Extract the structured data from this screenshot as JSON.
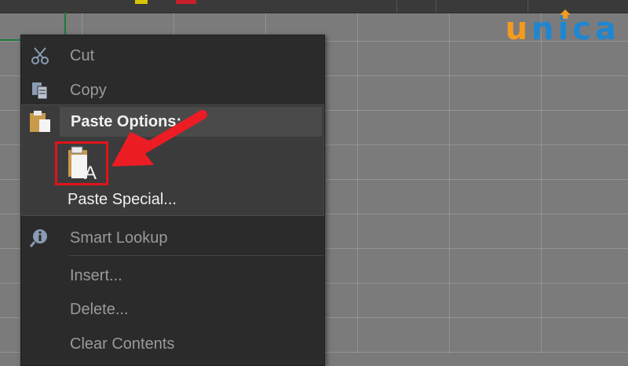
{
  "logo": {
    "text_u": "u",
    "text_n": "n",
    "text_i": "i",
    "text_c": "c",
    "text_a": "a",
    "color_orange": "#f39a1f",
    "color_blue": "#1f86d1"
  },
  "menu": {
    "cut": "Cut",
    "copy": "Copy",
    "paste_options": "Paste Options:",
    "paste_special": "Paste Special...",
    "smart_lookup": "Smart Lookup",
    "insert": "Insert...",
    "delete": "Delete...",
    "clear_contents": "Clear Contents"
  },
  "paste_button_letter": "A",
  "colors": {
    "highlight": "#e0141a",
    "menu_bg": "#2b2b2b",
    "grid_bg": "#7b7b7b",
    "selection_green": "#1e7a3a"
  },
  "icons": [
    "scissors-icon",
    "copy-icon",
    "clipboard-icon",
    "paste-keep-text-only-icon",
    "smart-lookup-icon",
    "arrow-indicator"
  ]
}
